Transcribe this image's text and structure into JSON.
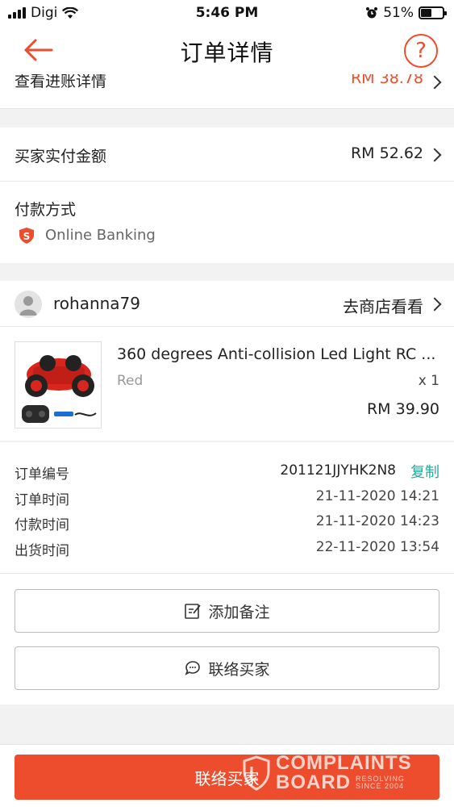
{
  "status_bar": {
    "carrier": "Digi",
    "time": "5:46 PM",
    "battery": "51%"
  },
  "nav": {
    "title": "订单详情",
    "help": "?"
  },
  "partial_row": {
    "label": "查看进账详情",
    "value": "RM 38.78"
  },
  "payment": {
    "amount_label": "买家实付金额",
    "amount_value": "RM 52.62",
    "method_label": "付款方式",
    "method_value": "Online Banking"
  },
  "buyer": {
    "username": "rohanna79",
    "shop_link": "去商店看看"
  },
  "product": {
    "name": "360 degrees Anti-collision Led Light RC ...",
    "variation": "Red",
    "quantity": "x 1",
    "price": "RM 39.90"
  },
  "order_info": {
    "order_no_label": "订单编号",
    "order_no": "201121JJYHK2N8",
    "copy": "复制",
    "order_time_label": "订单时间",
    "order_time": "21-11-2020 14:21",
    "payment_time_label": "付款时间",
    "payment_time": "21-11-2020 14:23",
    "ship_time_label": "出货时间",
    "ship_time": "22-11-2020 13:54"
  },
  "actions": {
    "add_note": "添加备注",
    "contact_buyer": "联络买家"
  },
  "bottom": {
    "primary": "联络买家"
  },
  "watermark": {
    "line1": "COMPLAINTS",
    "line2": "BOARD",
    "tag1": "RESOLVING",
    "tag2": "SINCE 2004"
  },
  "colors": {
    "accent": "#ee4d2d",
    "copy": "#26aa99"
  }
}
